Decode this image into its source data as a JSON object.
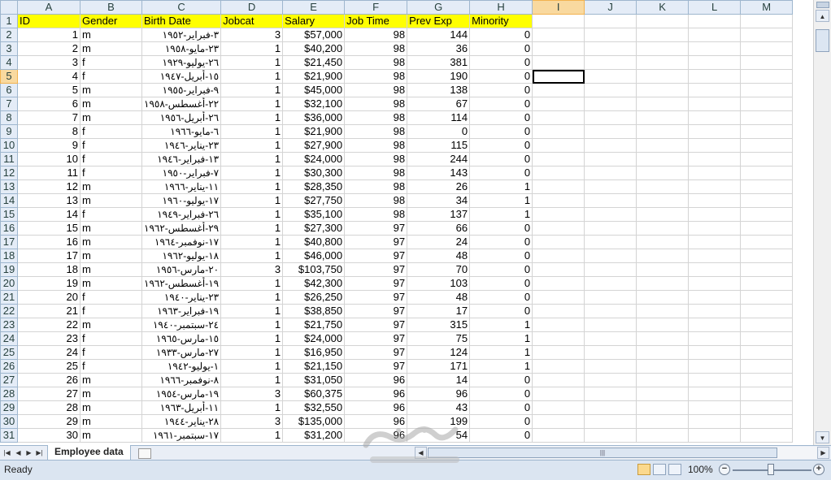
{
  "columns": [
    "A",
    "B",
    "C",
    "D",
    "E",
    "F",
    "G",
    "H",
    "I",
    "J",
    "K",
    "L",
    "M"
  ],
  "active_cell": {
    "col": "I",
    "row": 5
  },
  "header_row": [
    "ID",
    "Gender",
    "Birth Date",
    "Jobcat",
    "Salary",
    "Job Time",
    "Prev Exp",
    "Minority"
  ],
  "rows": [
    [
      "1",
      "m",
      "٣-فبراير-١٩٥٢",
      "3",
      "$57,000",
      "98",
      "144",
      "0"
    ],
    [
      "2",
      "m",
      "٢٣-مايو-١٩٥٨",
      "1",
      "$40,200",
      "98",
      "36",
      "0"
    ],
    [
      "3",
      "f",
      "٢٦-يوليو-١٩٢٩",
      "1",
      "$21,450",
      "98",
      "381",
      "0"
    ],
    [
      "4",
      "f",
      "١٥-أبريل-١٩٤٧",
      "1",
      "$21,900",
      "98",
      "190",
      "0"
    ],
    [
      "5",
      "m",
      "٩-فبراير-١٩٥٥",
      "1",
      "$45,000",
      "98",
      "138",
      "0"
    ],
    [
      "6",
      "m",
      "٢٢-أغسطس-١٩٥٨",
      "1",
      "$32,100",
      "98",
      "67",
      "0"
    ],
    [
      "7",
      "m",
      "٢٦-أبريل-١٩٥٦",
      "1",
      "$36,000",
      "98",
      "114",
      "0"
    ],
    [
      "8",
      "f",
      "٦-مايو-١٩٦٦",
      "1",
      "$21,900",
      "98",
      "0",
      "0"
    ],
    [
      "9",
      "f",
      "٢٣-يناير-١٩٤٦",
      "1",
      "$27,900",
      "98",
      "115",
      "0"
    ],
    [
      "10",
      "f",
      "١٣-فبراير-١٩٤٦",
      "1",
      "$24,000",
      "98",
      "244",
      "0"
    ],
    [
      "11",
      "f",
      "٧-فبراير-١٩٥٠",
      "1",
      "$30,300",
      "98",
      "143",
      "0"
    ],
    [
      "12",
      "m",
      "١١-يناير-١٩٦٦",
      "1",
      "$28,350",
      "98",
      "26",
      "1"
    ],
    [
      "13",
      "m",
      "١٧-يوليو-١٩٦٠",
      "1",
      "$27,750",
      "98",
      "34",
      "1"
    ],
    [
      "14",
      "f",
      "٢٦-فبراير-١٩٤٩",
      "1",
      "$35,100",
      "98",
      "137",
      "1"
    ],
    [
      "15",
      "m",
      "٢٩-أغسطس-١٩٦٢",
      "1",
      "$27,300",
      "97",
      "66",
      "0"
    ],
    [
      "16",
      "m",
      "١٧-نوفمبر-١٩٦٤",
      "1",
      "$40,800",
      "97",
      "24",
      "0"
    ],
    [
      "17",
      "m",
      "١٨-يوليو-١٩٦٢",
      "1",
      "$46,000",
      "97",
      "48",
      "0"
    ],
    [
      "18",
      "m",
      "٢٠-مارس-١٩٥٦",
      "3",
      "$103,750",
      "97",
      "70",
      "0"
    ],
    [
      "19",
      "m",
      "١٩-أغسطس-١٩٦٢",
      "1",
      "$42,300",
      "97",
      "103",
      "0"
    ],
    [
      "20",
      "f",
      "٢٣-يناير-١٩٤٠",
      "1",
      "$26,250",
      "97",
      "48",
      "0"
    ],
    [
      "21",
      "f",
      "١٩-فبراير-١٩٦٣",
      "1",
      "$38,850",
      "97",
      "17",
      "0"
    ],
    [
      "22",
      "m",
      "٢٤-سبتمبر-١٩٤٠",
      "1",
      "$21,750",
      "97",
      "315",
      "1"
    ],
    [
      "23",
      "f",
      "١٥-مارس-١٩٦٥",
      "1",
      "$24,000",
      "97",
      "75",
      "1"
    ],
    [
      "24",
      "f",
      "٢٧-مارس-١٩٣٣",
      "1",
      "$16,950",
      "97",
      "124",
      "1"
    ],
    [
      "25",
      "f",
      "١-يوليو-١٩٤٢",
      "1",
      "$21,150",
      "97",
      "171",
      "1"
    ],
    [
      "26",
      "m",
      "٨-نوفمبر-١٩٦٦",
      "1",
      "$31,050",
      "96",
      "14",
      "0"
    ],
    [
      "27",
      "m",
      "١٩-مارس-١٩٥٤",
      "3",
      "$60,375",
      "96",
      "96",
      "0"
    ],
    [
      "28",
      "m",
      "١١-أبريل-١٩٦٣",
      "1",
      "$32,550",
      "96",
      "43",
      "0"
    ],
    [
      "29",
      "m",
      "٢٨-يناير-١٩٤٤",
      "3",
      "$135,000",
      "96",
      "199",
      "0"
    ],
    [
      "30",
      "m",
      "١٧-سبتمبر-١٩٦١",
      "1",
      "$31,200",
      "96",
      "54",
      "0"
    ]
  ],
  "sheet_tab": {
    "name": "Employee data"
  },
  "status": {
    "text": "Ready",
    "zoom": "100%"
  },
  "watermark": {
    "text": "mostaql.com"
  }
}
